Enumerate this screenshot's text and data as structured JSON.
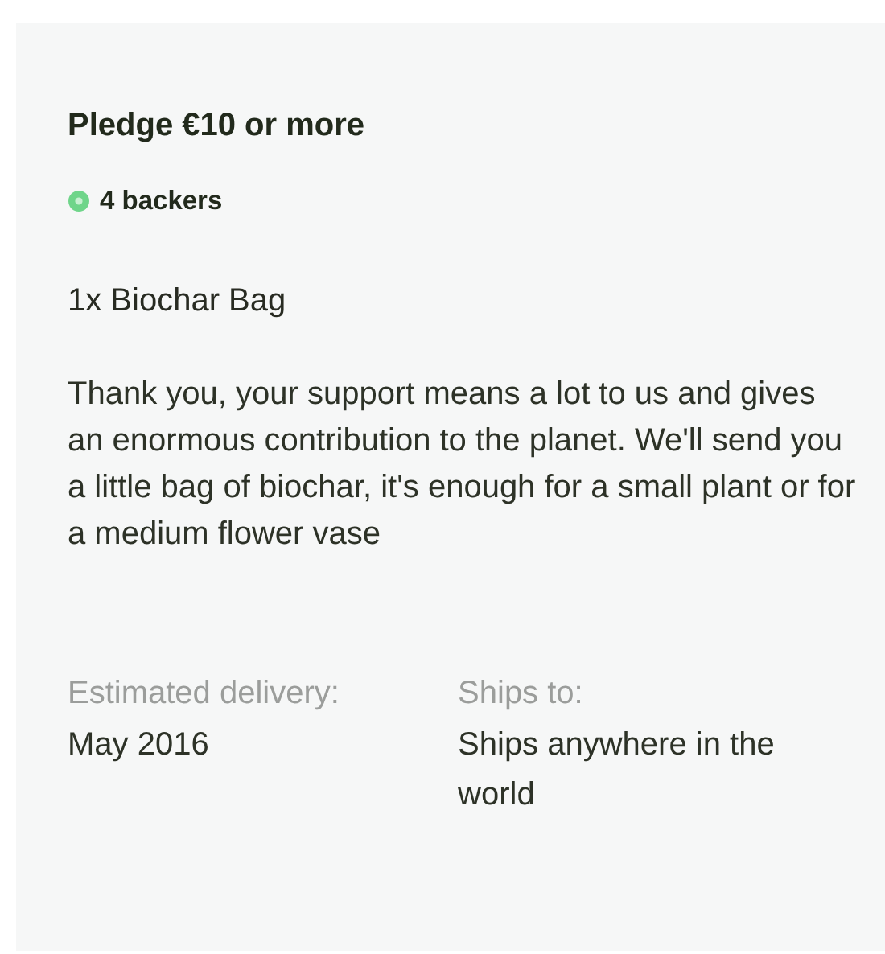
{
  "reward": {
    "title": "Pledge €10 or more",
    "backers": "4 backers",
    "item": "1x Biochar Bag",
    "description": "Thank you, your support means a lot to us and gives an enormous contribution to the planet. We'll send you a little bag of biochar, it's enough for a small plant or for a medium flower vase",
    "details": [
      {
        "label": "Estimated delivery:",
        "value": "May 2016"
      },
      {
        "label": "Ships to:",
        "value": "Ships anywhere in the world"
      }
    ]
  }
}
